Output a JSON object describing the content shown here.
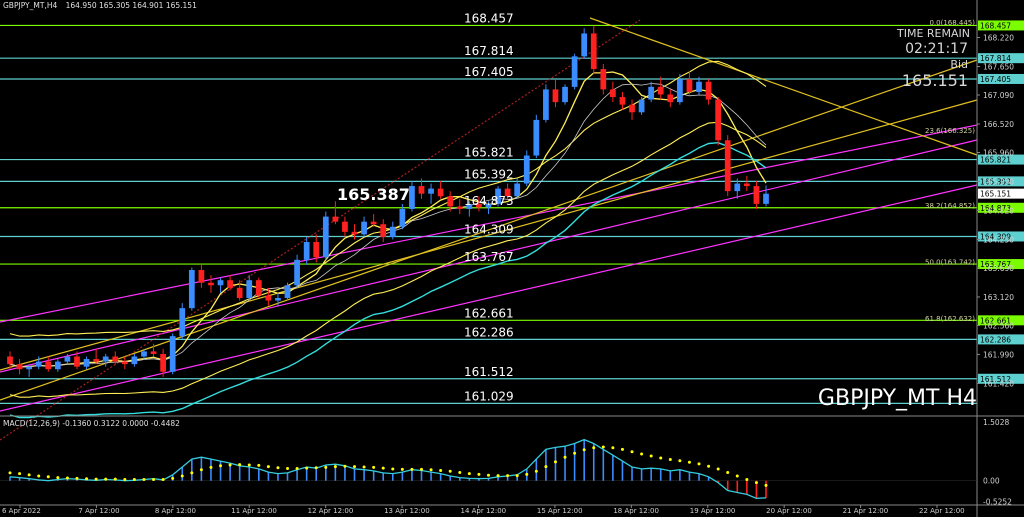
{
  "header": {
    "symbol": "GBPJPY_MT,H4",
    "ohlc": "164.950 165.305 164.901 165.151"
  },
  "overlay": {
    "time_remain_label": "TIME REMAIN",
    "time_remain_value": "02:21:17",
    "bid_label": "Bid",
    "bid_value": "165.151",
    "watermark": "GBPJPY_MT H4",
    "big_price": "165.387"
  },
  "chart_data": {
    "type": "candlestick",
    "y_range": [
      160.8,
      168.8
    ],
    "price_ticks": [
      "168.220",
      "167.650",
      "167.090",
      "166.520",
      "165.960",
      "165.390",
      "164.820",
      "164.250",
      "163.690",
      "163.120",
      "162.560",
      "161.990",
      "161.420"
    ],
    "levels": [
      {
        "value": 168.457,
        "label": "168.457",
        "color": "#7CFC00",
        "axis_label": "168.457"
      },
      {
        "value": 167.814,
        "label": "167.814",
        "color": "#5fd0d0",
        "axis_label": "167.814"
      },
      {
        "value": 167.405,
        "label": "167.405",
        "color": "#5fd0d0",
        "axis_label": "167.405"
      },
      {
        "value": 165.821,
        "label": "165.821",
        "color": "#5fd0d0",
        "axis_label": "165.821"
      },
      {
        "value": 165.392,
        "label": "165.392",
        "color": "#5fd0d0",
        "axis_label": "165.392"
      },
      {
        "value": 164.873,
        "label": "164.873",
        "color": "#7CFC00",
        "axis_label": "164.873"
      },
      {
        "value": 164.309,
        "label": "164.309",
        "color": "#5fd0d0",
        "axis_label": "164.309"
      },
      {
        "value": 163.767,
        "label": "163.767",
        "color": "#7CFC00",
        "axis_label": "163.767"
      },
      {
        "value": 162.661,
        "label": "162.661",
        "color": "#7CFC00",
        "axis_label": "162.661"
      },
      {
        "value": 162.286,
        "label": "162.286",
        "color": "#5fd0d0",
        "axis_label": "162.286"
      },
      {
        "value": 161.512,
        "label": "161.512",
        "color": "#5fd0d0",
        "axis_label": "161.512"
      },
      {
        "value": 161.029,
        "label": "161.029",
        "color": "#5fd0d0",
        "axis_label": ""
      }
    ],
    "fib_labels": [
      {
        "value": 168.445,
        "text": "0.0(168.445)"
      },
      {
        "value": 166.325,
        "text": "23.6(166.325)"
      },
      {
        "value": 164.852,
        "text": "38.2(164.852)"
      },
      {
        "value": 163.742,
        "text": "50.0(163.742)"
      },
      {
        "value": 162.632,
        "text": "61.8(162.632)"
      }
    ],
    "current_price": 165.151,
    "x_labels": [
      "6 Apr 2022",
      "7 Apr 12:00",
      "8 Apr 12:00",
      "11 Apr 12:00",
      "12 Apr 12:00",
      "13 Apr 12:00",
      "14 Apr 12:00",
      "15 Apr 12:00",
      "18 Apr 12:00",
      "19 Apr 12:00",
      "20 Apr 12:00",
      "21 Apr 12:00",
      "22 Apr 12:00"
    ],
    "candles": [
      [
        161.95,
        162.05,
        161.7,
        161.8
      ],
      [
        161.8,
        161.9,
        161.6,
        161.7
      ],
      [
        161.7,
        161.8,
        161.55,
        161.75
      ],
      [
        161.75,
        161.95,
        161.7,
        161.85
      ],
      [
        161.85,
        161.95,
        161.65,
        161.7
      ],
      [
        161.7,
        161.9,
        161.65,
        161.85
      ],
      [
        161.85,
        162.0,
        161.8,
        161.95
      ],
      [
        161.95,
        162.05,
        161.7,
        161.75
      ],
      [
        161.75,
        161.95,
        161.7,
        161.9
      ],
      [
        161.9,
        162.1,
        161.8,
        161.85
      ],
      [
        161.85,
        162.0,
        161.75,
        161.95
      ],
      [
        161.95,
        162.05,
        161.8,
        161.85
      ],
      [
        161.85,
        161.95,
        161.7,
        161.8
      ],
      [
        161.8,
        162.0,
        161.75,
        161.95
      ],
      [
        161.95,
        162.1,
        161.9,
        162.05
      ],
      [
        162.05,
        162.2,
        161.95,
        162.0
      ],
      [
        162.0,
        162.1,
        161.55,
        161.65
      ],
      [
        161.65,
        162.4,
        161.6,
        162.35
      ],
      [
        162.35,
        163.0,
        162.3,
        162.9
      ],
      [
        162.9,
        163.7,
        162.85,
        163.65
      ],
      [
        163.65,
        163.75,
        163.3,
        163.4
      ],
      [
        163.4,
        163.55,
        163.2,
        163.35
      ],
      [
        163.35,
        163.5,
        163.2,
        163.45
      ],
      [
        163.45,
        163.55,
        163.25,
        163.3
      ],
      [
        163.3,
        163.45,
        163.05,
        163.1
      ],
      [
        163.1,
        163.55,
        163.05,
        163.45
      ],
      [
        163.45,
        163.5,
        163.1,
        163.15
      ],
      [
        163.15,
        163.3,
        162.95,
        163.05
      ],
      [
        163.05,
        163.2,
        162.95,
        163.1
      ],
      [
        163.1,
        163.4,
        163.05,
        163.35
      ],
      [
        163.35,
        163.95,
        163.3,
        163.85
      ],
      [
        163.85,
        164.3,
        163.75,
        164.2
      ],
      [
        164.2,
        164.35,
        163.8,
        163.9
      ],
      [
        163.9,
        164.8,
        163.85,
        164.7
      ],
      [
        164.7,
        165.0,
        164.55,
        164.6
      ],
      [
        164.6,
        164.7,
        164.3,
        164.4
      ],
      [
        164.4,
        164.55,
        164.25,
        164.35
      ],
      [
        164.35,
        164.7,
        164.3,
        164.6
      ],
      [
        164.6,
        164.75,
        164.5,
        164.55
      ],
      [
        164.55,
        164.65,
        164.2,
        164.3
      ],
      [
        164.3,
        164.6,
        164.25,
        164.5
      ],
      [
        164.5,
        164.95,
        164.45,
        164.85
      ],
      [
        164.85,
        165.4,
        164.8,
        165.3
      ],
      [
        165.3,
        165.45,
        165.05,
        165.15
      ],
      [
        165.15,
        165.35,
        164.95,
        165.25
      ],
      [
        165.25,
        165.4,
        165.05,
        165.1
      ],
      [
        165.1,
        165.2,
        164.8,
        164.9
      ],
      [
        164.9,
        165.05,
        164.75,
        164.85
      ],
      [
        164.85,
        165.0,
        164.7,
        164.95
      ],
      [
        164.95,
        165.1,
        164.8,
        164.88
      ],
      [
        164.88,
        165.0,
        164.75,
        164.95
      ],
      [
        164.95,
        165.3,
        164.9,
        165.25
      ],
      [
        165.25,
        165.35,
        165.05,
        165.1
      ],
      [
        165.1,
        165.45,
        165.05,
        165.35
      ],
      [
        165.35,
        166.0,
        165.3,
        165.9
      ],
      [
        165.9,
        166.7,
        165.85,
        166.6
      ],
      [
        166.6,
        167.3,
        166.55,
        167.2
      ],
      [
        167.2,
        167.4,
        166.85,
        166.95
      ],
      [
        166.95,
        167.3,
        166.9,
        167.25
      ],
      [
        167.25,
        167.9,
        167.2,
        167.85
      ],
      [
        167.85,
        168.4,
        167.8,
        168.3
      ],
      [
        168.3,
        168.45,
        167.5,
        167.6
      ],
      [
        167.6,
        167.7,
        167.1,
        167.2
      ],
      [
        167.2,
        167.35,
        166.95,
        167.05
      ],
      [
        167.05,
        167.15,
        166.8,
        166.9
      ],
      [
        166.9,
        167.0,
        166.6,
        166.75
      ],
      [
        166.75,
        167.05,
        166.7,
        167.0
      ],
      [
        167.0,
        167.35,
        166.95,
        167.25
      ],
      [
        167.25,
        167.45,
        167.0,
        167.1
      ],
      [
        167.1,
        167.2,
        166.85,
        166.95
      ],
      [
        166.95,
        167.5,
        166.9,
        167.4
      ],
      [
        167.4,
        167.55,
        167.1,
        167.15
      ],
      [
        167.15,
        167.45,
        167.1,
        167.35
      ],
      [
        167.35,
        167.4,
        166.9,
        167.0
      ],
      [
        167.0,
        167.05,
        166.1,
        166.2
      ],
      [
        166.2,
        166.3,
        165.1,
        165.2
      ],
      [
        165.2,
        165.45,
        165.05,
        165.35
      ],
      [
        165.35,
        165.5,
        165.2,
        165.3
      ],
      [
        165.3,
        165.4,
        164.85,
        164.95
      ],
      [
        164.95,
        165.31,
        164.9,
        165.15
      ]
    ],
    "macd": {
      "label": "MACD(12,26,9) -0.1360 0.3122 0.0000 -0.4482",
      "y_range": [
        -0.62,
        1.6
      ],
      "ticks": [
        "1.5028",
        "0.00",
        "-0.5252"
      ],
      "hist": [
        0.1,
        0.08,
        0.05,
        0.02,
        0.0,
        0.03,
        0.05,
        0.04,
        0.02,
        0.01,
        0.03,
        0.02,
        0.0,
        0.01,
        0.03,
        0.05,
        0.02,
        0.15,
        0.35,
        0.55,
        0.6,
        0.55,
        0.5,
        0.45,
        0.38,
        0.35,
        0.3,
        0.22,
        0.18,
        0.2,
        0.28,
        0.35,
        0.32,
        0.4,
        0.42,
        0.38,
        0.3,
        0.28,
        0.25,
        0.2,
        0.18,
        0.22,
        0.28,
        0.26,
        0.22,
        0.18,
        0.12,
        0.08,
        0.06,
        0.05,
        0.06,
        0.1,
        0.12,
        0.15,
        0.3,
        0.55,
        0.8,
        0.85,
        0.88,
        0.95,
        1.05,
        0.95,
        0.8,
        0.65,
        0.5,
        0.35,
        0.3,
        0.32,
        0.3,
        0.25,
        0.28,
        0.22,
        0.18,
        0.1,
        -0.05,
        -0.25,
        -0.3,
        -0.35,
        -0.45,
        -0.44
      ],
      "signal": [
        0.2,
        0.18,
        0.15,
        0.12,
        0.1,
        0.08,
        0.07,
        0.06,
        0.05,
        0.04,
        0.04,
        0.04,
        0.03,
        0.03,
        0.03,
        0.03,
        0.03,
        0.06,
        0.12,
        0.2,
        0.28,
        0.34,
        0.38,
        0.4,
        0.41,
        0.4,
        0.39,
        0.36,
        0.33,
        0.31,
        0.31,
        0.32,
        0.33,
        0.34,
        0.36,
        0.37,
        0.36,
        0.35,
        0.34,
        0.32,
        0.3,
        0.29,
        0.29,
        0.29,
        0.28,
        0.26,
        0.24,
        0.21,
        0.18,
        0.16,
        0.14,
        0.13,
        0.13,
        0.13,
        0.16,
        0.24,
        0.36,
        0.48,
        0.6,
        0.7,
        0.79,
        0.84,
        0.86,
        0.84,
        0.8,
        0.74,
        0.68,
        0.63,
        0.58,
        0.54,
        0.51,
        0.47,
        0.43,
        0.37,
        0.3,
        0.21,
        0.12,
        0.03,
        -0.05,
        -0.12
      ]
    }
  }
}
